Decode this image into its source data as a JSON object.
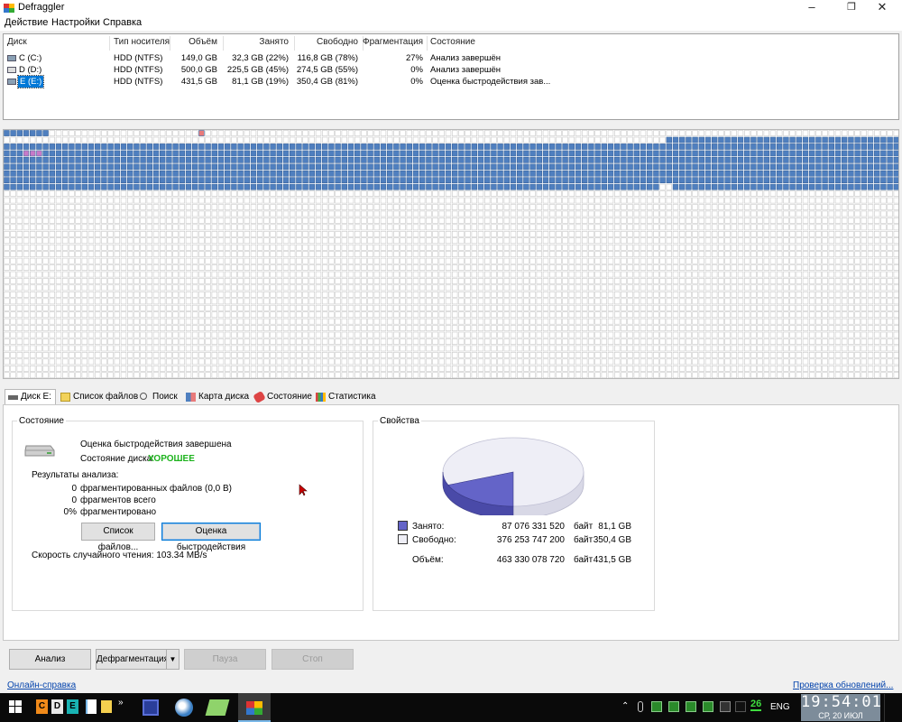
{
  "window": {
    "title": "Defraggler"
  },
  "menu": [
    "Действие",
    "Настройки",
    "Справка"
  ],
  "drives": {
    "columns": [
      "Диск",
      "Тип носителя",
      "Объём",
      "Занято",
      "Свободно",
      "Фрагментация",
      "Состояние"
    ],
    "rows": [
      {
        "name": "C (C:)",
        "type": "HDD (NTFS)",
        "size": "149,0 GB",
        "used": "32,3 GB (22%)",
        "free": "116,8 GB (78%)",
        "frag": "27%",
        "status": "Анализ завершён"
      },
      {
        "name": "D (D:)",
        "type": "HDD (NTFS)",
        "size": "500,0 GB",
        "used": "225,5 GB (45%)",
        "free": "274,5 GB (55%)",
        "frag": "0%",
        "status": "Анализ завершён"
      },
      {
        "name": "E (E:)",
        "type": "HDD (NTFS)",
        "size": "431,5 GB",
        "used": "81,1 GB (19%)",
        "free": "350,4 GB (81%)",
        "frag": "0%",
        "status": "Оценка быстродействия зав..."
      }
    ],
    "selected_row": 2
  },
  "disk_map": {
    "used_color": "#4f7fbf",
    "free_color": "#ffffff",
    "fragment_color": "#e87a7a",
    "mft_color": "#c77ac7"
  },
  "tabs": [
    "Диск E:",
    "Список файлов",
    "Поиск",
    "Карта диска",
    "Состояние",
    "Статистика"
  ],
  "active_tab": 0,
  "status_group": {
    "title": "Состояние",
    "message": "Оценка быстродействия завершена",
    "disk_state_label": "Состояние диска:",
    "disk_state_value": "ХОРОШЕЕ",
    "disk_state_color": "#1db31d",
    "results_title": "Результаты анализа:",
    "results": [
      {
        "value": "0",
        "label": "фрагментированных файлов (0,0 B)"
      },
      {
        "value": "0",
        "label": "фрагментов всего"
      },
      {
        "value": "0%",
        "label": "фрагментировано"
      }
    ],
    "file_list_button": "Список файлов...",
    "benchmark_button": "Оценка быстродействия",
    "read_speed": "Скорость случайного чтения: 103.34 MB/s"
  },
  "properties_group": {
    "title": "Свойства",
    "used_label": "Занято:",
    "used_bytes": "87 076 331 520",
    "used_unit": "байт",
    "used_gb": "81,1 GB",
    "free_label": "Свободно:",
    "free_bytes": "376 253 747 200",
    "free_unit": "байт",
    "free_gb": "350,4 GB",
    "total_label": "Объём:",
    "total_bytes": "463 330 078 720",
    "total_unit": "байт",
    "total_gb": "431,5 GB",
    "used_fraction": 0.188,
    "used_color": "#6464c8",
    "free_color": "#eeeef6"
  },
  "actions": {
    "analyze": "Анализ",
    "defrag": "Дефрагментация",
    "pause": "Пауза",
    "stop": "Стоп"
  },
  "footer": {
    "help_link": "Онлайн-справка",
    "update_link": "Проверка обновлений..."
  },
  "taskbar": {
    "quick_letters": [
      "C",
      "D",
      "E"
    ],
    "tray_number": "26",
    "lang": "ENG",
    "time": "19:54:01",
    "date": "СР, 20 ИЮЛ"
  }
}
